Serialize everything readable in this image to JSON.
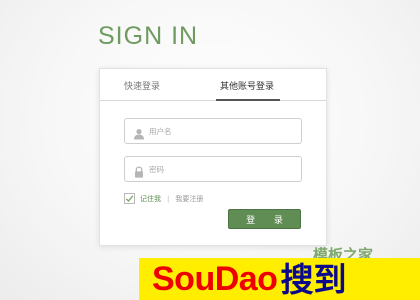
{
  "page": {
    "title": "SIGN IN"
  },
  "tabs": [
    {
      "label": "快速登录",
      "active": false
    },
    {
      "label": "其他账号登录",
      "active": true
    }
  ],
  "form": {
    "username_placeholder": "用户名",
    "password_placeholder": "密码",
    "remember_label": "记住我",
    "separator": "|",
    "register_label": "我要注册",
    "login_button": "登 录",
    "icons": {
      "username": "user-icon",
      "password": "lock-icon",
      "remember": "checkmark-icon"
    }
  },
  "watermark": {
    "cn_text": "模板之家",
    "banner_text": "SouDao",
    "banner_cn": "搜到"
  },
  "colors": {
    "accent_green": "#5f8d54",
    "title_green": "#6f9a60",
    "banner_yellow": "#ffee00",
    "banner_red": "#ee0000",
    "banner_navy": "#0a0a8a"
  }
}
